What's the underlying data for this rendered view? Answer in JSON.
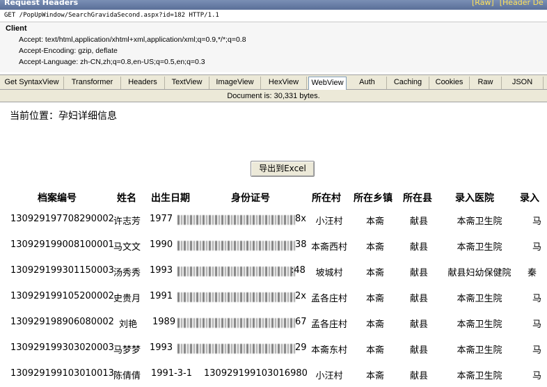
{
  "request_headers": {
    "title": "Request Headers",
    "raw_link": "[Raw]",
    "header_defs_link": "[Header De",
    "request_line": "GET /PopUpWindow/SearchGravidaSecond.aspx?id=182 HTTP/1.1",
    "group": "Client",
    "rows": [
      "Accept: text/html,application/xhtml+xml,application/xml;q=0.9,*/*;q=0.8",
      "Accept-Encoding: gzip, deflate",
      "Accept-Language: zh-CN,zh;q=0.8,en-US;q=0.5,en;q=0.3"
    ]
  },
  "tabs": [
    {
      "label": "Get SyntaxView",
      "active": false
    },
    {
      "label": "Transformer",
      "active": false
    },
    {
      "label": "Headers",
      "active": false
    },
    {
      "label": "TextView",
      "active": false
    },
    {
      "label": "ImageView",
      "active": false
    },
    {
      "label": "HexView",
      "active": false
    },
    {
      "label": "WebView",
      "active": true
    },
    {
      "label": "Auth",
      "active": false
    },
    {
      "label": "Caching",
      "active": false
    },
    {
      "label": "Cookies",
      "active": false
    },
    {
      "label": "Raw",
      "active": false
    },
    {
      "label": "JSON",
      "active": false
    }
  ],
  "status": "Document is: 30,331 bytes.",
  "page": {
    "location": "当前位置：孕妇详细信息",
    "export_button": "导出到Excel",
    "columns": [
      "档案编号",
      "姓名",
      "出生日期",
      "身份证号",
      "所在村",
      "所在乡镇",
      "所在县",
      "录入医院",
      "录入"
    ],
    "rows": [
      [
        "130929197708290002",
        "许志芳",
        "1977",
        "8x",
        "小汪村",
        "本斋",
        "献县",
        "本斋卫生院",
        "马"
      ],
      [
        "130929199008100001",
        "马文文",
        "1990",
        "38",
        "本斋西村",
        "本斋",
        "献县",
        "本斋卫生院",
        "马"
      ],
      [
        "130929199301150003",
        "汤秀秀",
        "1993",
        ":48",
        "坡城村",
        "本斋",
        "献县",
        "献县妇幼保健院",
        "秦"
      ],
      [
        "130929199105200002",
        "史贵月",
        "1991",
        "2x",
        "孟各庄村",
        "本斋",
        "献县",
        "本斋卫生院",
        "马"
      ],
      [
        "130929198906080002",
        "刘艳",
        "1989",
        "67",
        "孟各庄村",
        "本斋",
        "献县",
        "本斋卫生院",
        "马"
      ],
      [
        "130929199303020003",
        "马梦梦",
        "1993",
        "29",
        "本斋东村",
        "本斋",
        "献县",
        "本斋卫生院",
        "马"
      ],
      [
        "130929199103010013",
        "陈倩倩",
        "1991-3-1",
        "130929199103016980",
        "小汪村",
        "本斋",
        "献县",
        "本斋卫生院",
        "马"
      ]
    ]
  }
}
